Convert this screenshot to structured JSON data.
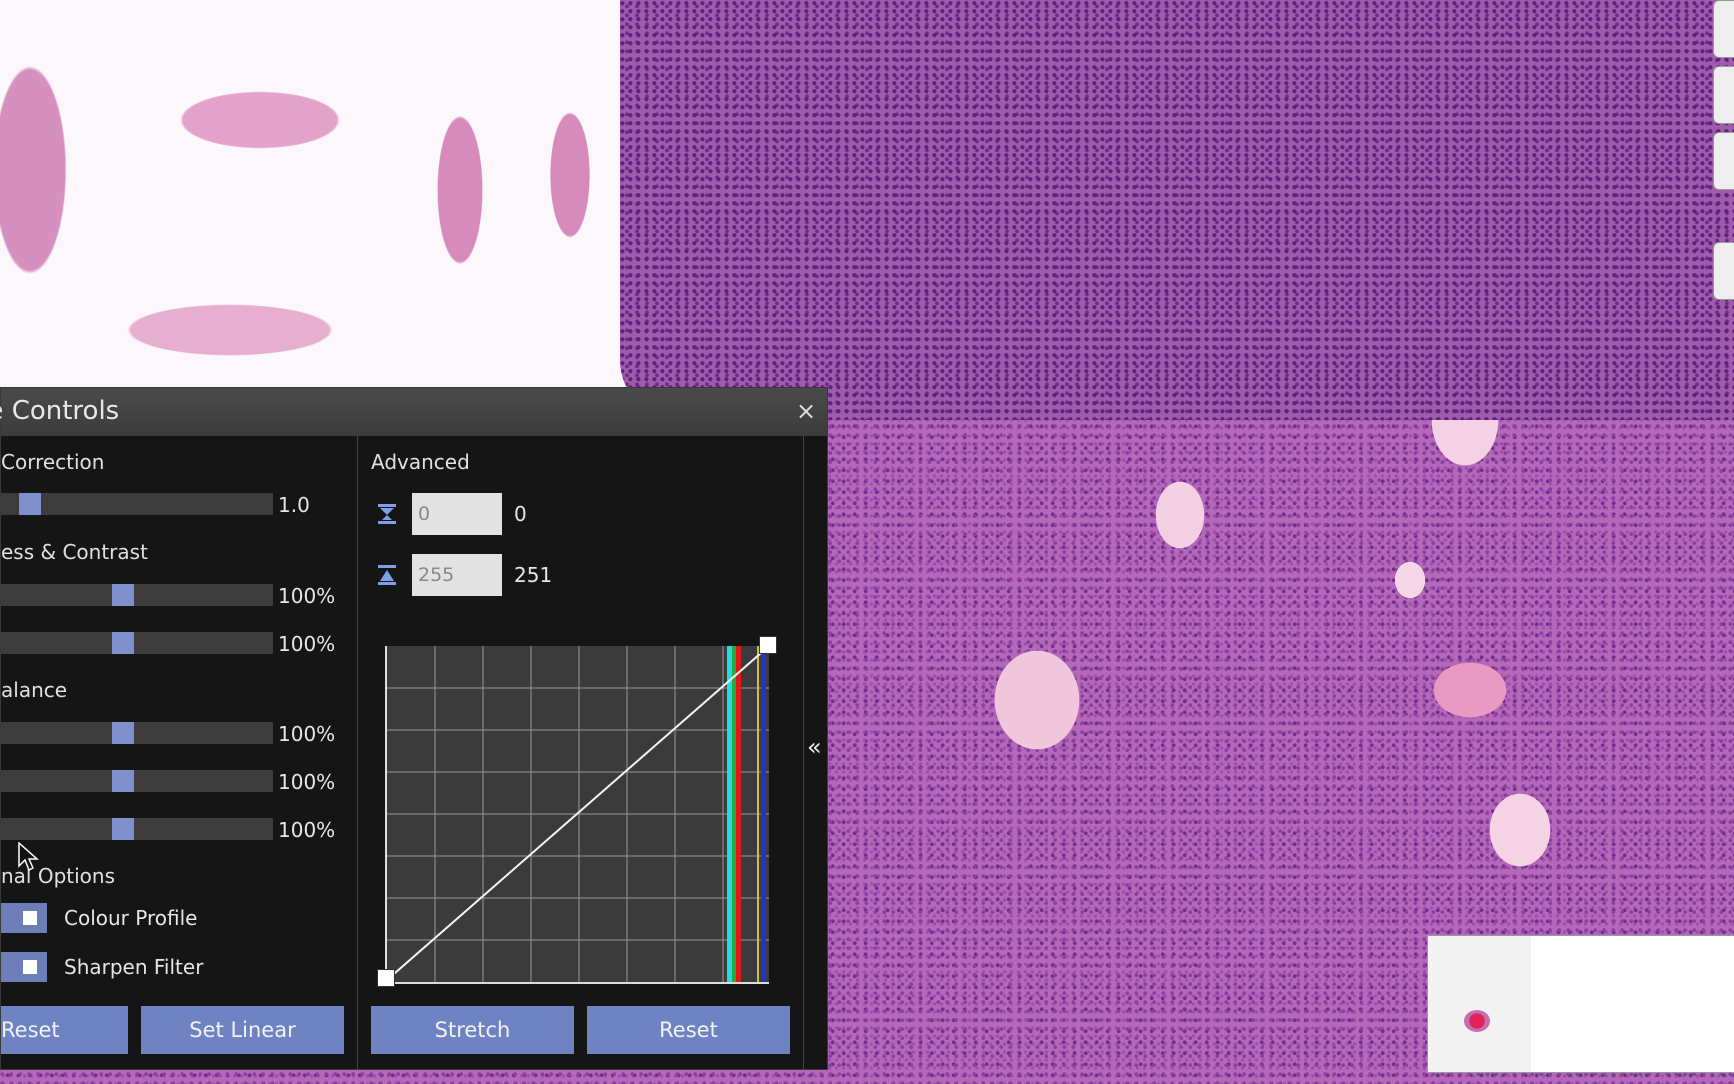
{
  "panel": {
    "title": "age Controls",
    "close_glyph": "×",
    "collapse_glyph": "«"
  },
  "left": {
    "gamma": {
      "label": " Correction",
      "value": "1.0",
      "level": 0.1
    },
    "brightness_contrast": {
      "label": "ess & Contrast",
      "brightness": {
        "value": "100%",
        "level": 0.45
      },
      "contrast": {
        "value": "100%",
        "level": 0.45
      }
    },
    "colour_balance": {
      "label": "alance",
      "red": {
        "value": "100%",
        "level": 0.45
      },
      "green": {
        "value": "100%",
        "level": 0.45
      },
      "blue": {
        "value": "100%",
        "level": 0.45
      }
    },
    "additional_options": {
      "label": "nal Options",
      "colour_profile": "Colour Profile",
      "sharpen_filter": "Sharpen Filter"
    },
    "buttons": {
      "reset": "Reset",
      "set_linear": "Set Linear"
    }
  },
  "advanced": {
    "label": "Advanced",
    "black_point": {
      "input": "0",
      "value": "0",
      "icon": "black-point-icon"
    },
    "white_point": {
      "input": "255",
      "value": "251",
      "icon": "white-point-icon"
    },
    "buttons": {
      "stretch": "Stretch",
      "reset": "Reset"
    }
  },
  "colors": {
    "accent": "#6f82c2",
    "panel_bg": "#151515",
    "histogram_blue": "#2233cc",
    "histogram_red": "#e01818",
    "histogram_green": "#22aa44",
    "histogram_cyan": "#22dddd"
  }
}
